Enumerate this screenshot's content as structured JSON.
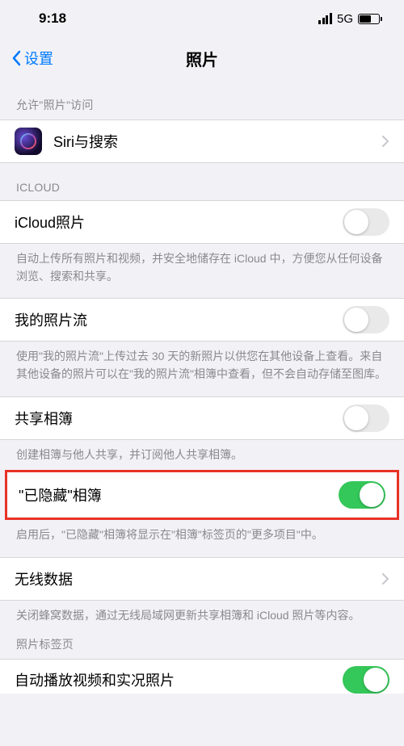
{
  "status": {
    "time": "9:18",
    "network": "5G"
  },
  "nav": {
    "back": "设置",
    "title": "照片"
  },
  "section_allow": {
    "header": "允许\"照片\"访问",
    "siri_label": "Siri与搜索"
  },
  "section_icloud": {
    "header": "ICLOUD",
    "icloud_photos": {
      "label": "iCloud照片",
      "on": false
    },
    "icloud_footer": "自动上传所有照片和视频，并安全地储存在 iCloud 中，方便您从任何设备浏览、搜索和共享。",
    "my_stream": {
      "label": "我的照片流",
      "on": false
    },
    "my_stream_footer": "使用\"我的照片流\"上传过去 30 天的新照片以供您在其他设备上查看。来自其他设备的照片可以在\"我的照片流\"相簿中查看，但不会自动存储至图库。",
    "shared_album": {
      "label": "共享相簿",
      "on": false
    },
    "shared_footer": "创建相簿与他人共享，并订阅他人共享相簿。"
  },
  "section_hidden": {
    "label": "\"已隐藏\"相簿",
    "on": true,
    "footer": "启用后，\"已隐藏\"相簿将显示在\"相簿\"标签页的\"更多项目\"中。"
  },
  "section_cellular": {
    "label": "无线数据",
    "footer": "关闭蜂窝数据，通过无线局域网更新共享相簿和 iCloud 照片等内容。"
  },
  "section_tabs": {
    "header": "照片标签页",
    "autoplay_label": "自动播放视频和实况照片",
    "autoplay_on": true
  }
}
